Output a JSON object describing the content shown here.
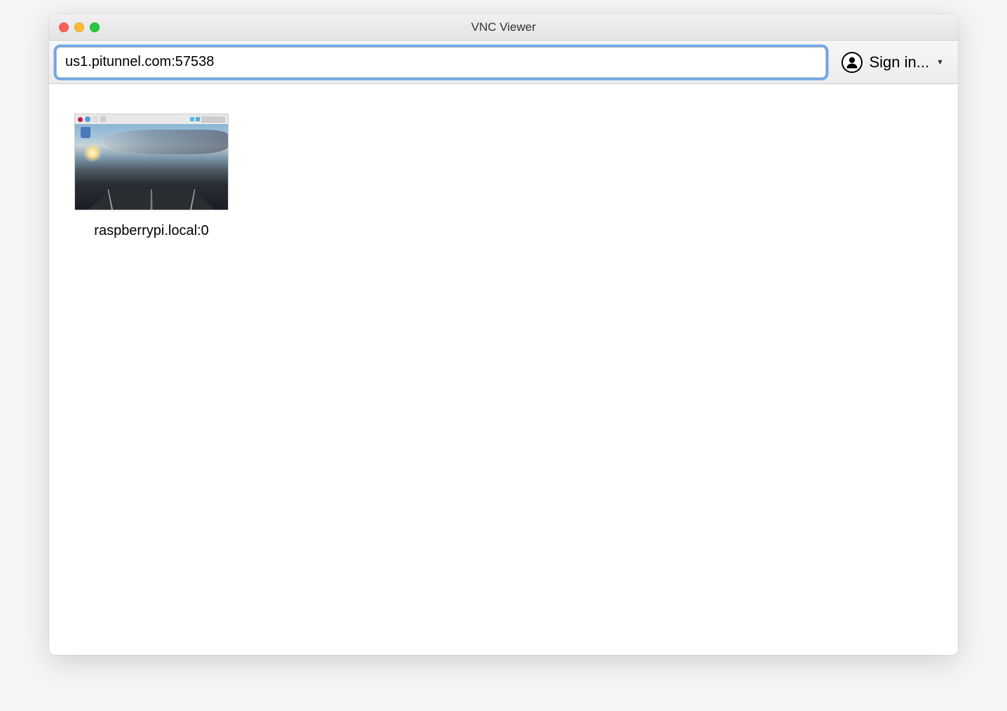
{
  "window": {
    "title": "VNC Viewer"
  },
  "toolbar": {
    "address_value": "us1.pitunnel.com:57538",
    "signin_label": "Sign in..."
  },
  "connections": [
    {
      "label": "raspberrypi.local:0"
    }
  ]
}
